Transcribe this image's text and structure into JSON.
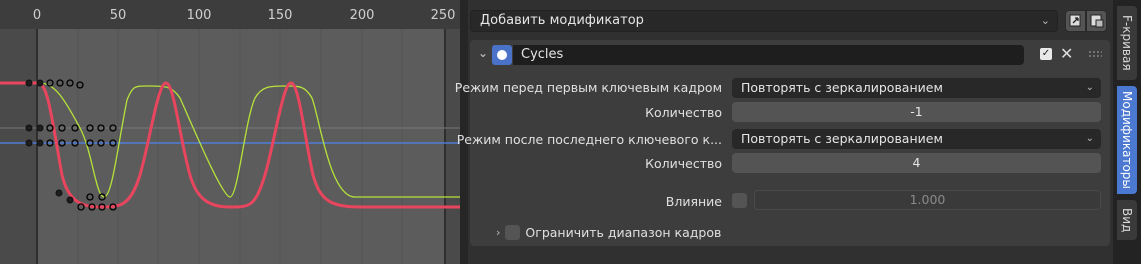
{
  "graph": {
    "frame_ticks": [
      "0",
      "50",
      "100",
      "150",
      "200",
      "250"
    ],
    "colors": {
      "red_curve": "#e8455e",
      "green_curve": "#b6e23a",
      "blue_line": "#4e7dd8"
    }
  },
  "panel": {
    "add_modifier_label": "Добавить модификатор",
    "modifier": {
      "name": "Cycles",
      "enabled": true,
      "before_mode_label": "Режим перед первым ключевым кадром",
      "before_mode_value": "Повторять с зеркалированием",
      "before_count_label": "Количество",
      "before_count_value": "-1",
      "after_mode_label": "Режим после последнего ключевого к...",
      "after_mode_value": "Повторять с зеркалированием",
      "after_count_label": "Количество",
      "after_count_value": "4",
      "influence_label": "Влияние",
      "influence_value": "1.000",
      "restrict_range_label": "Ограничить диапазон кадров"
    }
  },
  "tabs": {
    "f_curve": "F-кривая",
    "modifiers": "Модификаторы",
    "view": "Вид"
  }
}
